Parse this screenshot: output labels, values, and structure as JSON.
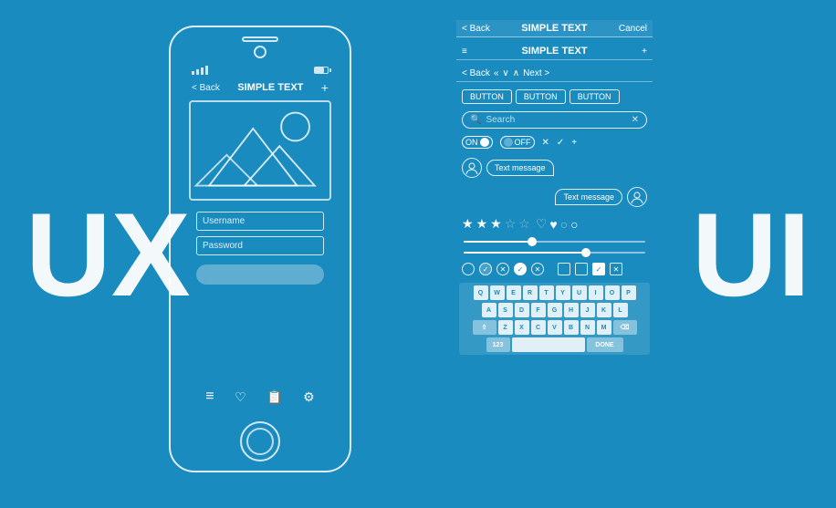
{
  "background": "#1a8bbf",
  "big_text": {
    "ux": "UX",
    "ui": "UI"
  },
  "phone": {
    "nav": {
      "back": "< Back",
      "title": "SIMPLE TEXT",
      "plus": "+"
    },
    "inputs": {
      "username": "Username",
      "password": "Password"
    },
    "bottom_icons": [
      "≡",
      "♡",
      "≡+",
      "⚙"
    ]
  },
  "ui_panel": {
    "navbar": {
      "back": "< Back",
      "title": "SIMPLE TEXT",
      "cancel": "Cancel"
    },
    "menu": {
      "hamburger": "≡",
      "title": "SIMPLE TEXT",
      "plus": "+"
    },
    "toolbar": {
      "back": "< Back",
      "prev_prev": "«",
      "prev": "∨",
      "next_sym": "∧",
      "next": ">",
      "next_label": "Next >"
    },
    "buttons": [
      "BUTTON",
      "BUTTON",
      "BUTTON"
    ],
    "search": {
      "placeholder": "Search",
      "close": "✕"
    },
    "toggles": {
      "on_label": "ON",
      "off_label": "OFF",
      "symbols": [
        "✕",
        "✓",
        "+"
      ]
    },
    "chat": {
      "message1": "Text message",
      "message2": "Text message"
    },
    "stars": [
      "★",
      "★",
      "★",
      "☆",
      "☆",
      "♡",
      "♥",
      "○",
      "○"
    ],
    "keyboard": {
      "row1": [
        "Q",
        "W",
        "E",
        "R",
        "T",
        "Y",
        "U",
        "I",
        "O",
        "P"
      ],
      "row2": [
        "A",
        "S",
        "D",
        "F",
        "G",
        "H",
        "J",
        "K",
        "L"
      ],
      "row3": [
        "⇧",
        "Z",
        "X",
        "C",
        "V",
        "B",
        "N",
        "M",
        "⌫"
      ],
      "row4": [
        "123",
        "",
        "",
        "DONE"
      ]
    }
  }
}
